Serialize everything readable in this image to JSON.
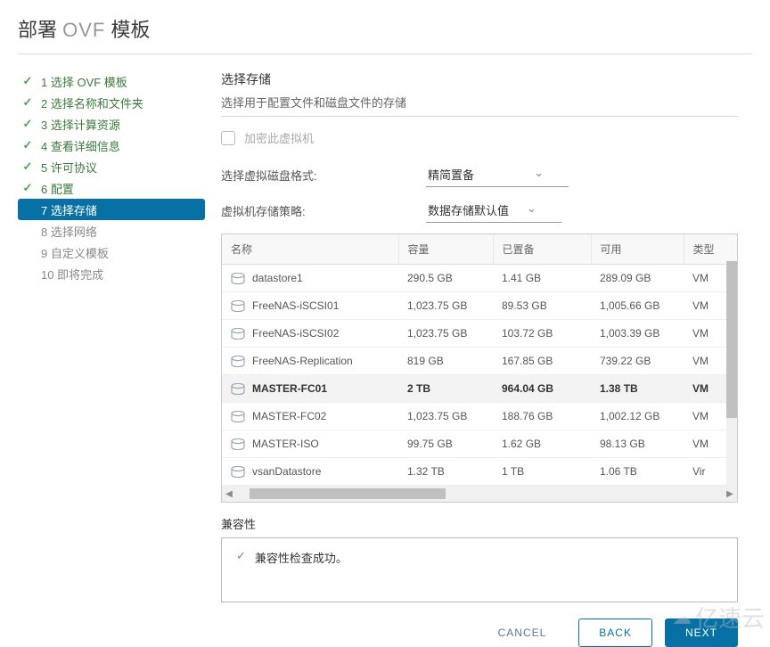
{
  "page_title_prefix": "部署",
  "page_title_mid": "OVF",
  "page_title_suffix": "模板",
  "steps": [
    {
      "num": "1",
      "label": "选择 OVF 模板",
      "state": "done"
    },
    {
      "num": "2",
      "label": "选择名称和文件夹",
      "state": "done"
    },
    {
      "num": "3",
      "label": "选择计算资源",
      "state": "done"
    },
    {
      "num": "4",
      "label": "查看详细信息",
      "state": "done"
    },
    {
      "num": "5",
      "label": "许可协议",
      "state": "done"
    },
    {
      "num": "6",
      "label": "配置",
      "state": "done"
    },
    {
      "num": "7",
      "label": "选择存储",
      "state": "current"
    },
    {
      "num": "8",
      "label": "选择网络",
      "state": "future"
    },
    {
      "num": "9",
      "label": "自定义模板",
      "state": "future"
    },
    {
      "num": "10",
      "label": "即将完成",
      "state": "future"
    }
  ],
  "section": {
    "title": "选择存储",
    "desc": "选择用于配置文件和磁盘文件的存储"
  },
  "encrypt_label": "加密此虚拟机",
  "disk_format_label": "选择虚拟磁盘格式:",
  "disk_format_value": "精简置备",
  "storage_policy_label": "虚拟机存储策略:",
  "storage_policy_value": "数据存储默认值",
  "table": {
    "headers": [
      "名称",
      "容量",
      "已置备",
      "可用",
      "类型"
    ],
    "rows": [
      {
        "name": "datastore1",
        "cap": "290.5 GB",
        "prov": "1.41 GB",
        "free": "289.09 GB",
        "type": "VM"
      },
      {
        "name": "FreeNAS-iSCSI01",
        "cap": "1,023.75 GB",
        "prov": "89.53 GB",
        "free": "1,005.66 GB",
        "type": "VM"
      },
      {
        "name": "FreeNAS-iSCSI02",
        "cap": "1,023.75 GB",
        "prov": "103.72 GB",
        "free": "1,003.39 GB",
        "type": "VM"
      },
      {
        "name": "FreeNAS-Replication",
        "cap": "819 GB",
        "prov": "167.85 GB",
        "free": "739.22 GB",
        "type": "VM"
      },
      {
        "name": "MASTER-FC01",
        "cap": "2 TB",
        "prov": "964.04 GB",
        "free": "1.38 TB",
        "type": "VM",
        "selected": true
      },
      {
        "name": "MASTER-FC02",
        "cap": "1,023.75 GB",
        "prov": "188.76 GB",
        "free": "1,002.12 GB",
        "type": "VM"
      },
      {
        "name": "MASTER-ISO",
        "cap": "99.75 GB",
        "prov": "1.62 GB",
        "free": "98.13 GB",
        "type": "VM"
      },
      {
        "name": "vsanDatastore",
        "cap": "1.32 TB",
        "prov": "1 TB",
        "free": "1.06 TB",
        "type": "Vir"
      }
    ]
  },
  "compat_label": "兼容性",
  "compat_msg": "兼容性检查成功。",
  "buttons": {
    "cancel": "CANCEL",
    "back": "BACK",
    "next": "NEXT"
  },
  "watermark": "亿速云"
}
